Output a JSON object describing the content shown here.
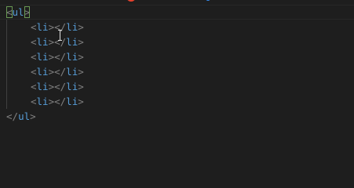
{
  "editor": {
    "lines": [
      {
        "open_bracket": "<",
        "tag": "ul",
        "close_bracket": ">"
      },
      {
        "open_bracket": "<",
        "tag": "li",
        "mid": "></",
        "end_tag": "li",
        "close_bracket": ">"
      },
      {
        "open_bracket": "<",
        "tag": "li",
        "mid": "></",
        "end_tag": "li",
        "close_bracket": ">"
      },
      {
        "open_bracket": "<",
        "tag": "li",
        "mid": "></",
        "end_tag": "li",
        "close_bracket": ">"
      },
      {
        "open_bracket": "<",
        "tag": "li",
        "mid": "></",
        "end_tag": "li",
        "close_bracket": ">"
      },
      {
        "open_bracket": "<",
        "tag": "li",
        "mid": "></",
        "end_tag": "li",
        "close_bracket": ">"
      },
      {
        "open_bracket": "<",
        "tag": "li",
        "mid": "></",
        "end_tag": "li",
        "close_bracket": ">"
      },
      {
        "open_bracket": "</",
        "tag": "ul",
        "close_bracket": ">"
      }
    ]
  },
  "colors": {
    "background": "#1e1e1e",
    "tag": "#569cd6",
    "bracket": "#808080",
    "bracket_match": "#6a9955"
  },
  "icons": [
    "text-cursor-icon"
  ]
}
